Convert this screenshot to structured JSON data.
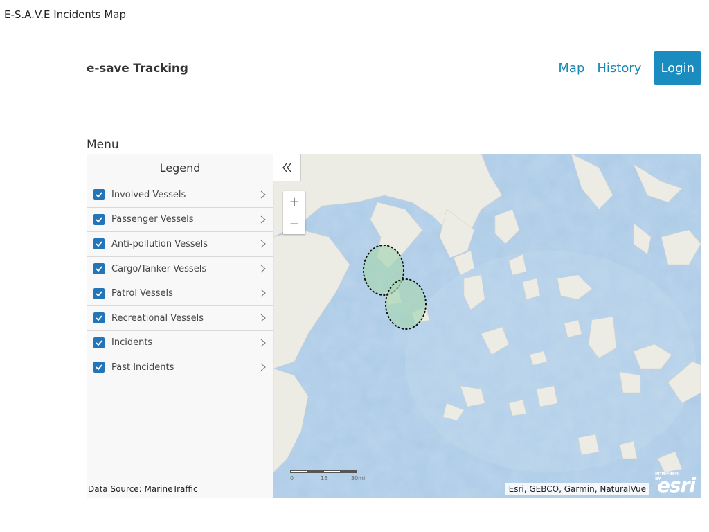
{
  "window": {
    "title": "E-S.A.V.E Incidents Map"
  },
  "navbar": {
    "brand": "e-save Tracking",
    "links": [
      {
        "label": "Map"
      },
      {
        "label": "History"
      }
    ],
    "login_label": "Login",
    "colors": {
      "link": "#1a86b4",
      "login_bg": "#1a8cc0"
    }
  },
  "menu": {
    "label": "Menu"
  },
  "legend": {
    "title": "Legend",
    "items": [
      {
        "label": "Involved Vessels",
        "checked": true
      },
      {
        "label": "Passenger Vessels",
        "checked": true
      },
      {
        "label": "Anti-pollution Vessels",
        "checked": true
      },
      {
        "label": "Cargo/Tanker Vessels",
        "checked": true
      },
      {
        "label": "Patrol Vessels",
        "checked": true
      },
      {
        "label": "Recreational Vessels",
        "checked": true
      },
      {
        "label": "Incidents",
        "checked": true
      },
      {
        "label": "Past Incidents",
        "checked": true
      }
    ],
    "data_source": "Data Source: MarineTraffic"
  },
  "map": {
    "controls": {
      "collapse_icon": "double-chevron-left-icon",
      "zoom_in": "+",
      "zoom_out": "−"
    },
    "scalebar": {
      "labels": [
        "0",
        "15",
        "30mi"
      ]
    },
    "attribution": "Esri, GEBCO, Garmin, NaturalVue",
    "logo": {
      "powered": "POWERED BY",
      "name": "esri"
    },
    "colors": {
      "sea": "#a9c9e6",
      "land": "#ecebe4",
      "incident_fill": "#a8d5b5"
    }
  }
}
